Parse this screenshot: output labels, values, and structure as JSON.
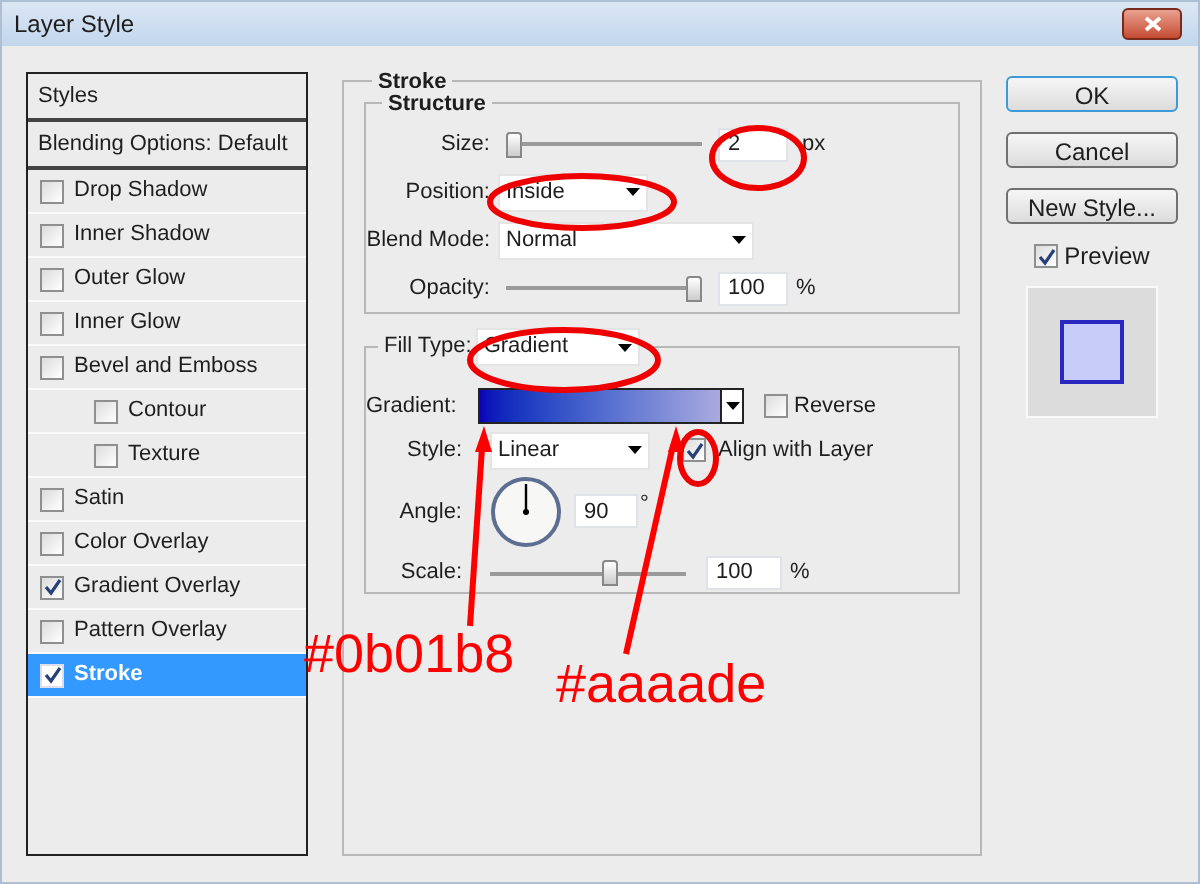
{
  "window": {
    "title": "Layer Style"
  },
  "styles_list": {
    "header": "Styles",
    "blending": "Blending Options: Default",
    "items": [
      {
        "label": "Drop Shadow",
        "checked": false,
        "selected": false
      },
      {
        "label": "Inner Shadow",
        "checked": false,
        "selected": false
      },
      {
        "label": "Outer Glow",
        "checked": false,
        "selected": false
      },
      {
        "label": "Inner Glow",
        "checked": false,
        "selected": false
      },
      {
        "label": "Bevel and Emboss",
        "checked": false,
        "selected": false,
        "children": [
          {
            "label": "Contour",
            "checked": false,
            "selected": false
          },
          {
            "label": "Texture",
            "checked": false,
            "selected": false
          }
        ]
      },
      {
        "label": "Satin",
        "checked": false,
        "selected": false
      },
      {
        "label": "Color Overlay",
        "checked": false,
        "selected": false
      },
      {
        "label": "Gradient Overlay",
        "checked": true,
        "selected": false
      },
      {
        "label": "Pattern Overlay",
        "checked": false,
        "selected": false
      },
      {
        "label": "Stroke",
        "checked": true,
        "selected": true
      }
    ]
  },
  "stroke": {
    "title": "Stroke",
    "structure": {
      "title": "Structure",
      "size": {
        "label": "Size:",
        "level": 0.0,
        "value": "2",
        "unit": "px"
      },
      "position": {
        "label": "Position:",
        "value": "Inside"
      },
      "blend_mode": {
        "label": "Blend Mode:",
        "value": "Normal"
      },
      "opacity": {
        "label": "Opacity:",
        "level": 1.0,
        "value": "100",
        "unit": "%"
      }
    },
    "fill": {
      "label": "Fill Type:",
      "value": "Gradient",
      "gradient": {
        "label": "Gradient:"
      },
      "reverse": {
        "label": "Reverse",
        "checked": false
      },
      "style": {
        "label": "Style:",
        "value": "Linear"
      },
      "align": {
        "label": "Align with Layer",
        "checked": true
      },
      "angle": {
        "label": "Angle:",
        "value": "90",
        "unit": "°"
      },
      "scale": {
        "label": "Scale:",
        "level": 0.62,
        "value": "100",
        "unit": "%"
      }
    }
  },
  "buttons": [
    {
      "label": "OK",
      "default": true
    },
    {
      "label": "Cancel",
      "default": false
    },
    {
      "label": "New Style...",
      "default": false
    }
  ],
  "preview": {
    "label": "Preview",
    "checked": true
  },
  "annotations": [
    {
      "text": "#0b01b8"
    },
    {
      "text": "#aaaade"
    }
  ]
}
